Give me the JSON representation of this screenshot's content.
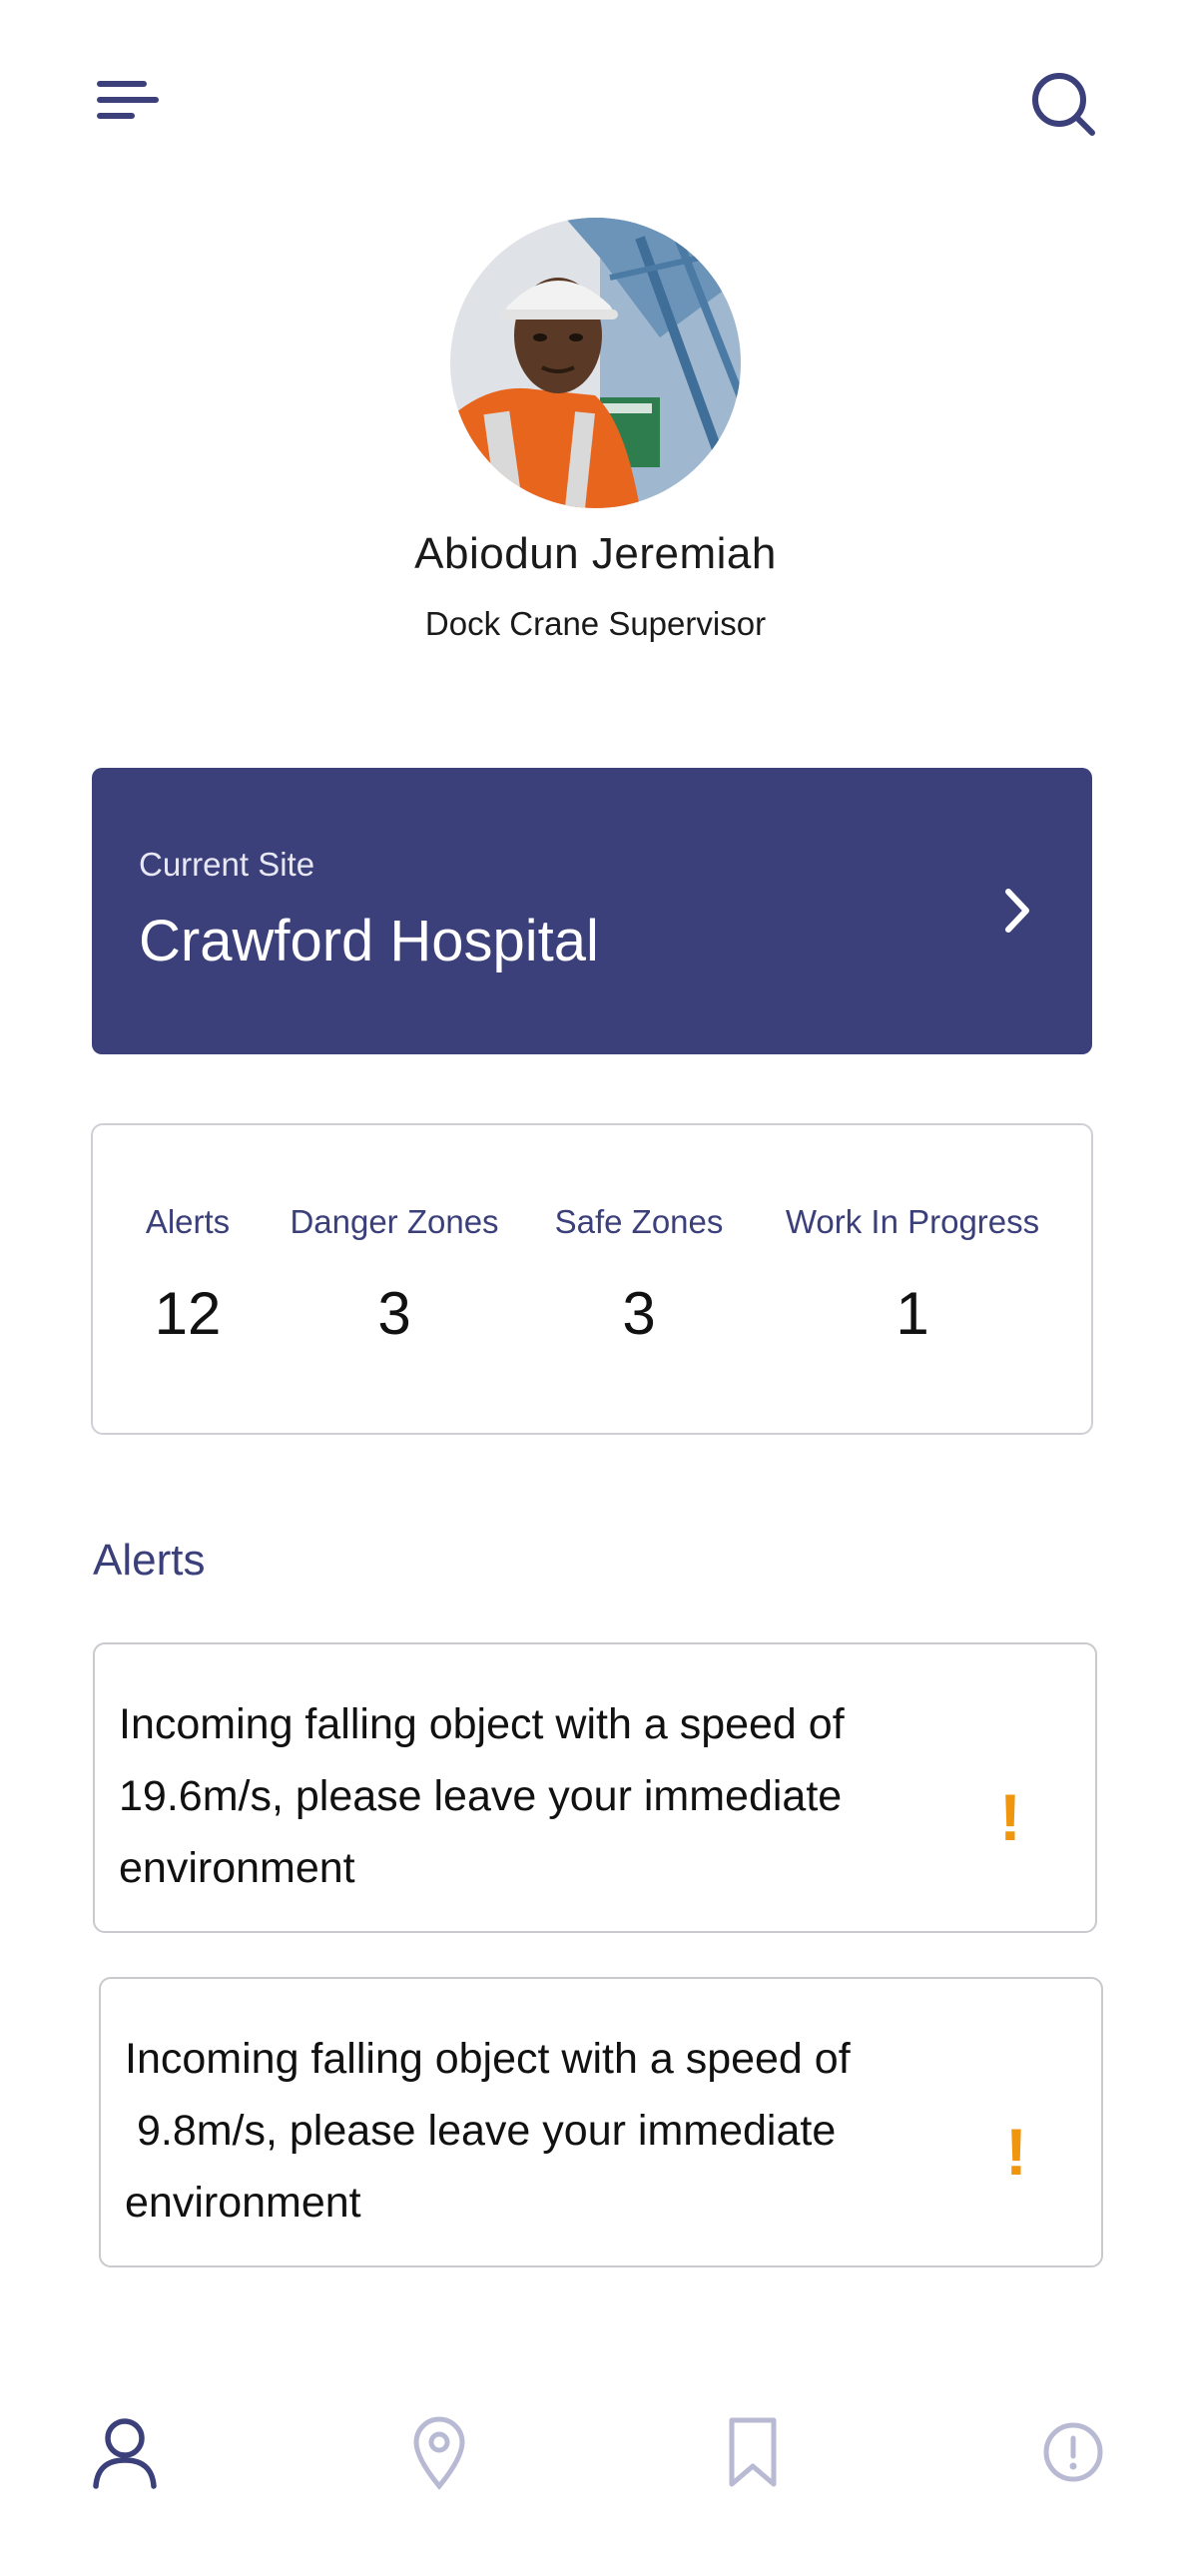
{
  "header": {
    "menu_icon": "hamburger-menu-icon",
    "search_icon": "search-icon"
  },
  "profile": {
    "name": "Abiodun Jeremiah",
    "role": "Dock Crane Supervisor",
    "avatar": "photo of worker in hard hat and orange safety vest"
  },
  "site": {
    "label": "Current Site",
    "name": "Crawford Hospital",
    "chevron_icon": "chevron-right-icon"
  },
  "stats": [
    {
      "label": "Alerts",
      "value": "12"
    },
    {
      "label": "Danger Zones",
      "value": "3"
    },
    {
      "label": "Safe Zones",
      "value": "3"
    },
    {
      "label": "Work In Progress",
      "value": "1"
    }
  ],
  "alerts_section": {
    "heading": "Alerts",
    "items": [
      {
        "text": "Incoming falling object with a speed of 19.6m/s, please leave your immediate environment",
        "mark": "!"
      },
      {
        "text": "Incoming falling object with a speed of\n 9.8m/s, please leave your immediate environment",
        "mark": "!"
      }
    ]
  },
  "bottom_nav": {
    "items": [
      {
        "icon": "person-icon",
        "active": true
      },
      {
        "icon": "location-pin-icon",
        "active": false
      },
      {
        "icon": "bookmark-icon",
        "active": false
      },
      {
        "icon": "alert-circle-icon",
        "active": false
      }
    ]
  },
  "colors": {
    "primary": "#3b3f7a",
    "warning": "#f0960e",
    "inactive_icon": "#b8bad3",
    "card_border": "#cfcfd6"
  }
}
